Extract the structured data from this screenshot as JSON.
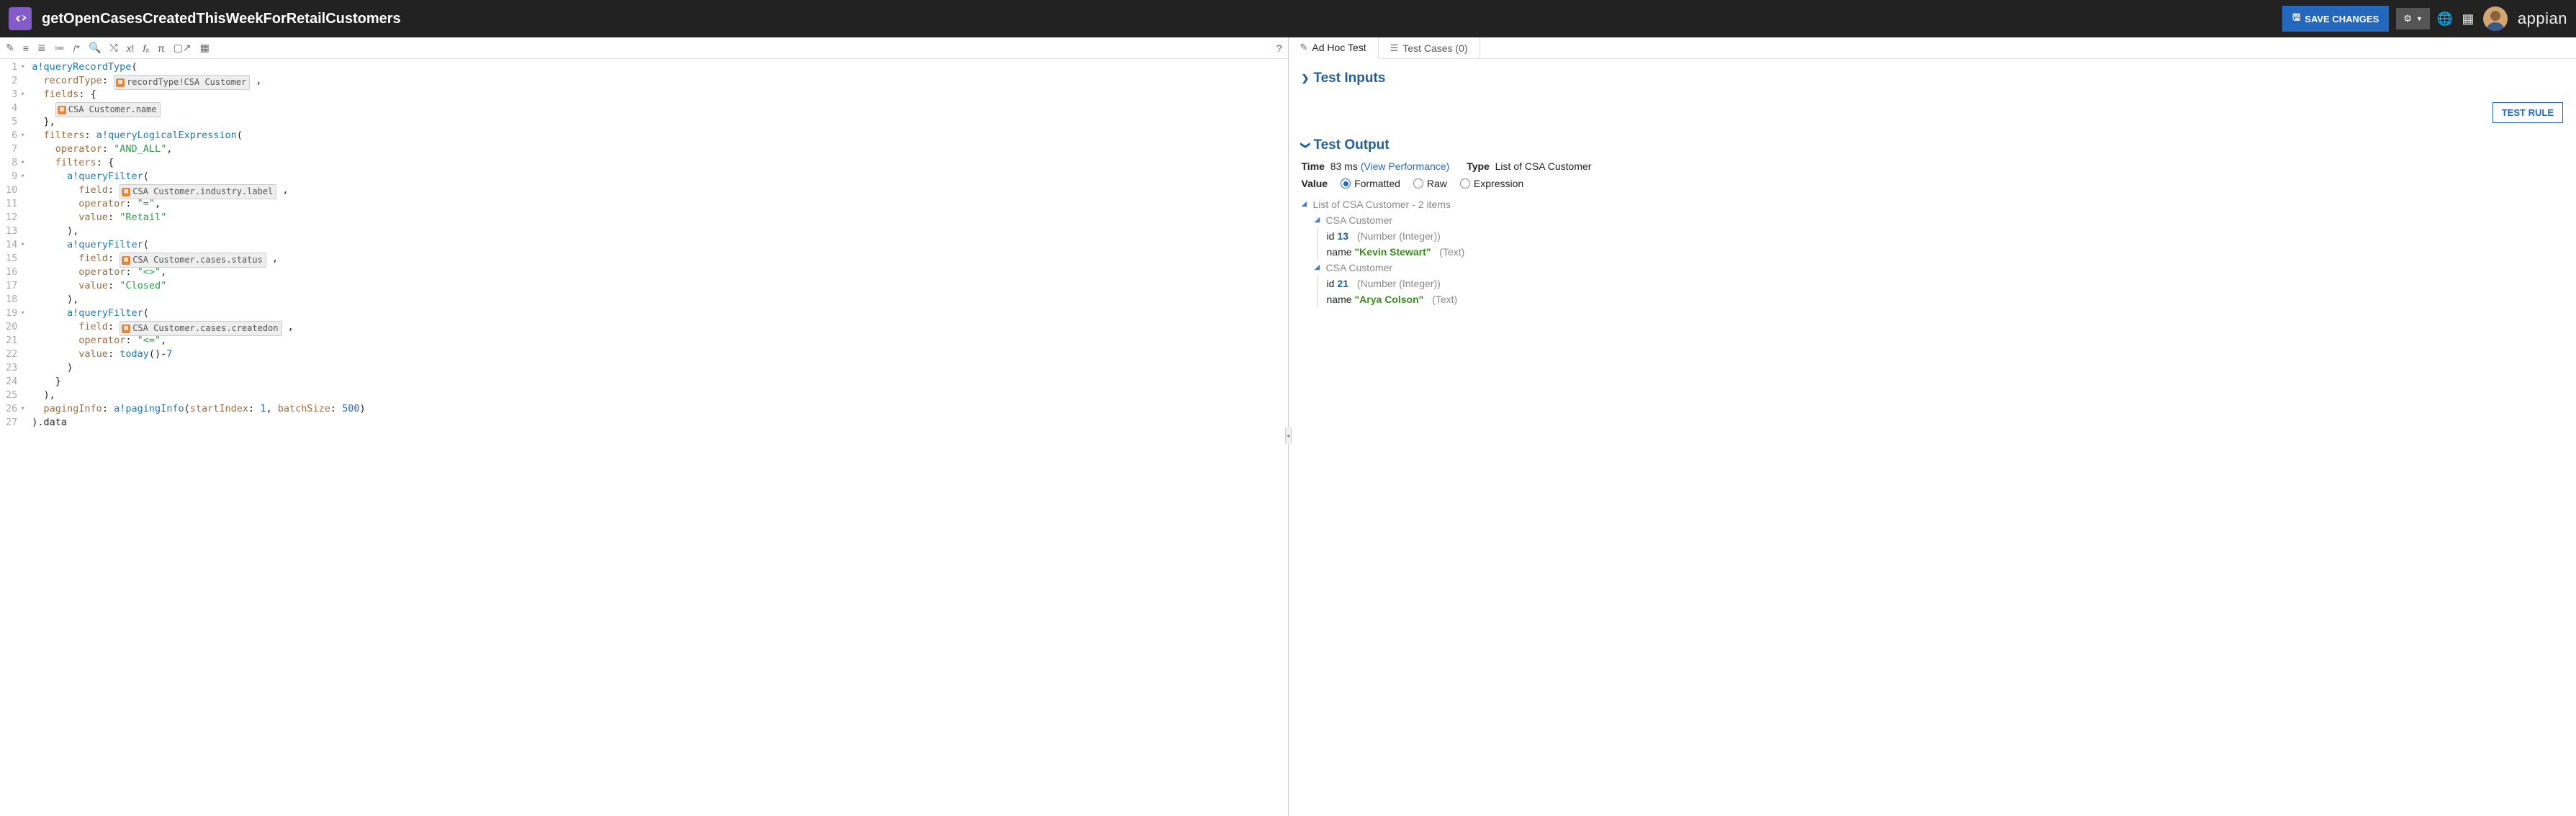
{
  "header": {
    "title": "getOpenCasesCreatedThisWeekForRetailCustomers",
    "save_button": "SAVE CHANGES",
    "brand": "appian"
  },
  "code": {
    "lines": [
      {
        "n": "1",
        "f": "▾",
        "html": "<span class='k-fn'>a!queryRecordType</span>("
      },
      {
        "n": "2",
        "f": "",
        "html": "  <span class='k-key'>recordType</span>: <span class='k-pill'><span class='pi'>▦</span>recordType!CSA Customer</span> ,"
      },
      {
        "n": "3",
        "f": "▾",
        "html": "  <span class='k-key'>fields</span>: {"
      },
      {
        "n": "4",
        "f": "",
        "html": "    <span class='k-pill'><span class='pi'>▦</span>CSA Customer.name</span>"
      },
      {
        "n": "5",
        "f": "",
        "html": "  },"
      },
      {
        "n": "6",
        "f": "▾",
        "html": "  <span class='k-key'>filters</span>: <span class='k-fn'>a!queryLogicalExpression</span>("
      },
      {
        "n": "7",
        "f": "",
        "html": "    <span class='k-key'>operator</span>: <span class='k-str'>\"AND_ALL\"</span>,"
      },
      {
        "n": "8",
        "f": "▾",
        "html": "    <span class='k-key'>filters</span>: {"
      },
      {
        "n": "9",
        "f": "▾",
        "html": "      <span class='k-fn'>a!queryFilter</span>("
      },
      {
        "n": "10",
        "f": "",
        "html": "        <span class='k-key'>field</span>: <span class='k-pill'><span class='pi'>▦</span>CSA Customer.industry.label</span> ,"
      },
      {
        "n": "11",
        "f": "",
        "html": "        <span class='k-key'>operator</span>: <span class='k-str'>\"=\"</span>,"
      },
      {
        "n": "12",
        "f": "",
        "html": "        <span class='k-key'>value</span>: <span class='k-str'>\"Retail\"</span>"
      },
      {
        "n": "13",
        "f": "",
        "html": "      ),"
      },
      {
        "n": "14",
        "f": "▾",
        "html": "      <span class='k-fn'>a!queryFilter</span>("
      },
      {
        "n": "15",
        "f": "",
        "html": "        <span class='k-key'>field</span>: <span class='k-pill'><span class='pi'>▦</span>CSA Customer.cases.status</span> ,"
      },
      {
        "n": "16",
        "f": "",
        "html": "        <span class='k-key'>operator</span>: <span class='k-str'>\"&lt;&gt;\"</span>,"
      },
      {
        "n": "17",
        "f": "",
        "html": "        <span class='k-key'>value</span>: <span class='k-str'>\"Closed\"</span>"
      },
      {
        "n": "18",
        "f": "",
        "html": "      ),"
      },
      {
        "n": "19",
        "f": "▾",
        "html": "      <span class='k-fn'>a!queryFilter</span>("
      },
      {
        "n": "20",
        "f": "",
        "html": "        <span class='k-key'>field</span>: <span class='k-pill'><span class='pi'>▦</span>CSA Customer.cases.createdon</span> ,"
      },
      {
        "n": "21",
        "f": "",
        "html": "        <span class='k-key'>operator</span>: <span class='k-str'>\"&lt;=\"</span>,"
      },
      {
        "n": "22",
        "f": "",
        "html": "        <span class='k-key'>value</span>: <span class='k-fn'>today</span>()-<span class='k-num'>7</span>"
      },
      {
        "n": "23",
        "f": "",
        "html": "      )"
      },
      {
        "n": "24",
        "f": "",
        "html": "    }"
      },
      {
        "n": "25",
        "f": "",
        "html": "  ),"
      },
      {
        "n": "26",
        "f": "▾",
        "html": "  <span class='k-key'>pagingInfo</span>: <span class='k-fn'>a!pagingInfo</span>(<span class='k-key'>startIndex</span>: <span class='k-num'>1</span>, <span class='k-key'>batchSize</span>: <span class='k-num'>500</span>)"
      },
      {
        "n": "27",
        "f": "",
        "html": ").data"
      }
    ]
  },
  "tabs": {
    "adhoc": "Ad Hoc Test",
    "cases": "Test Cases (0)"
  },
  "test_inputs": {
    "title": "Test Inputs"
  },
  "test_rule_btn": "TEST RULE",
  "test_output": {
    "title": "Test Output",
    "time_label": "Time",
    "time_value": "83 ms",
    "view_perf": "(View Performance)",
    "type_label": "Type",
    "type_value": "List of CSA Customer",
    "value_label": "Value",
    "fmt_formatted": "Formatted",
    "fmt_raw": "Raw",
    "fmt_expr": "Expression",
    "list_summary": "List of CSA Customer - 2 items",
    "items": [
      {
        "type": "CSA Customer",
        "id_label": "id",
        "id_val": "13",
        "id_type": "(Number (Integer))",
        "name_label": "name",
        "name_val": "\"Kevin Stewart\"",
        "name_type": "(Text)"
      },
      {
        "type": "CSA Customer",
        "id_label": "id",
        "id_val": "21",
        "id_type": "(Number (Integer))",
        "name_label": "name",
        "name_val": "\"Arya Colson\"",
        "name_type": "(Text)"
      }
    ]
  }
}
